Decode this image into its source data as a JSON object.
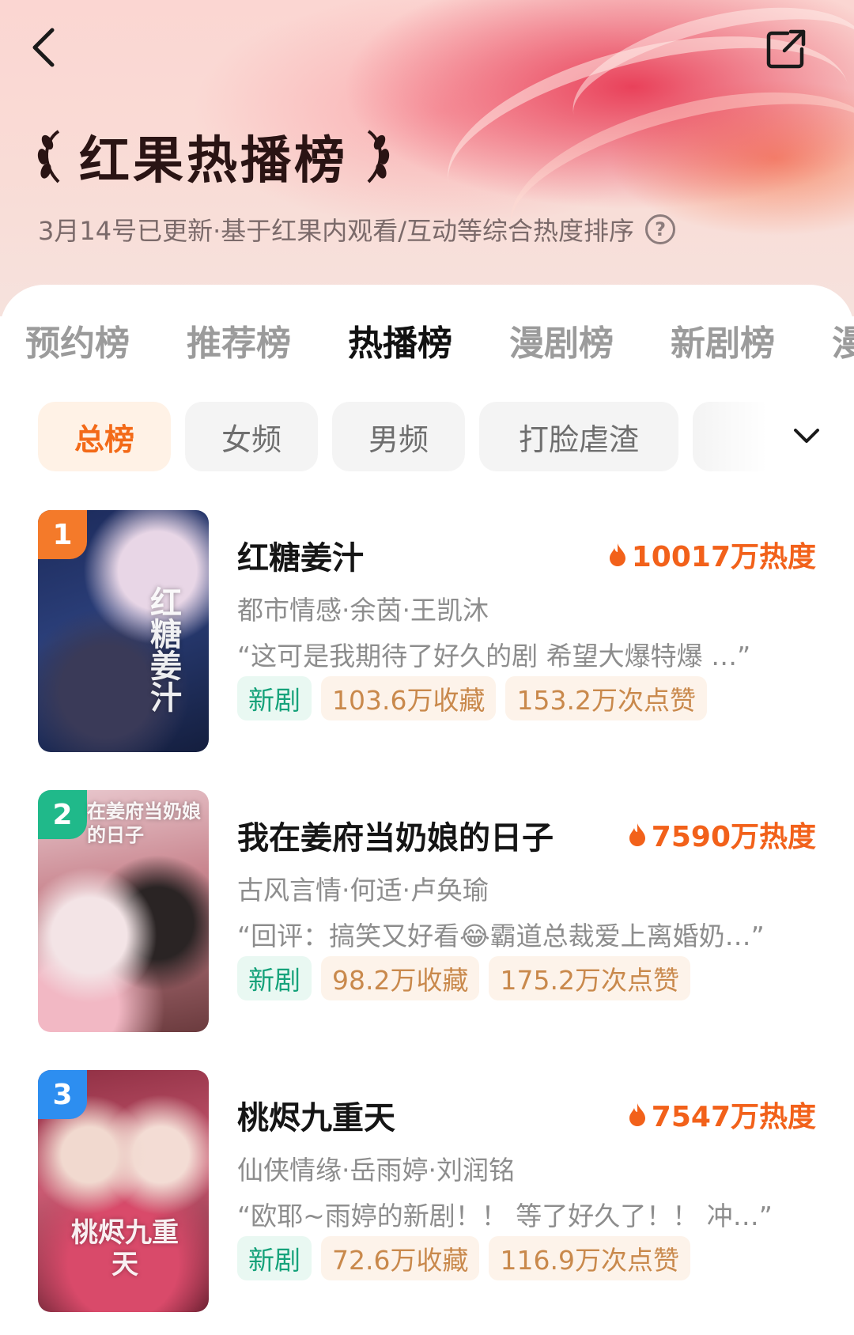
{
  "header": {
    "title": "红果热播榜",
    "subtitle": "3月14号已更新·基于红果内观看/互动等综合热度排序"
  },
  "tabs": [
    "预约榜",
    "推荐榜",
    "热播榜",
    "漫剧榜",
    "新剧榜",
    "漫"
  ],
  "active_tab": "热播榜",
  "chips": [
    "总榜",
    "女频",
    "男频",
    "打脸虐渣",
    ""
  ],
  "active_chip": "总榜",
  "items": [
    {
      "rank": "1",
      "rank_color": "#f47a2a",
      "poster_text": "红糖姜汁",
      "title": "红糖姜汁",
      "heat": "10017万热度",
      "meta": "都市情感·余茵·王凯沐",
      "quote": "“这可是我期待了好久的剧 希望大爆特爆 …”",
      "tags": [
        "新剧",
        "103.6万收藏",
        "153.2万次点赞"
      ]
    },
    {
      "rank": "2",
      "rank_color": "#20b98a",
      "poster_text": "在姜府当奶娘的日子",
      "title": "我在姜府当奶娘的日子",
      "heat": "7590万热度",
      "meta": "古风言情·何适·卢奂瑜",
      "quote": "“回评：搞笑又好看😂霸道总裁爱上离婚奶…”",
      "tags": [
        "新剧",
        "98.2万收藏",
        "175.2万次点赞"
      ]
    },
    {
      "rank": "3",
      "rank_color": "#2d8ef0",
      "poster_text": "桃烬九重天",
      "title": "桃烬九重天",
      "heat": "7547万热度",
      "meta": "仙侠情缘·岳雨婷·刘润铭",
      "quote": "“欧耶~雨婷的新剧！！ 等了好久了！！ 冲…”",
      "tags": [
        "新剧",
        "72.6万收藏",
        "116.9万次点赞"
      ]
    }
  ],
  "colors": {
    "accent": "#f36a18",
    "heat": "#f2611a",
    "new_tag": "#15a27a"
  }
}
